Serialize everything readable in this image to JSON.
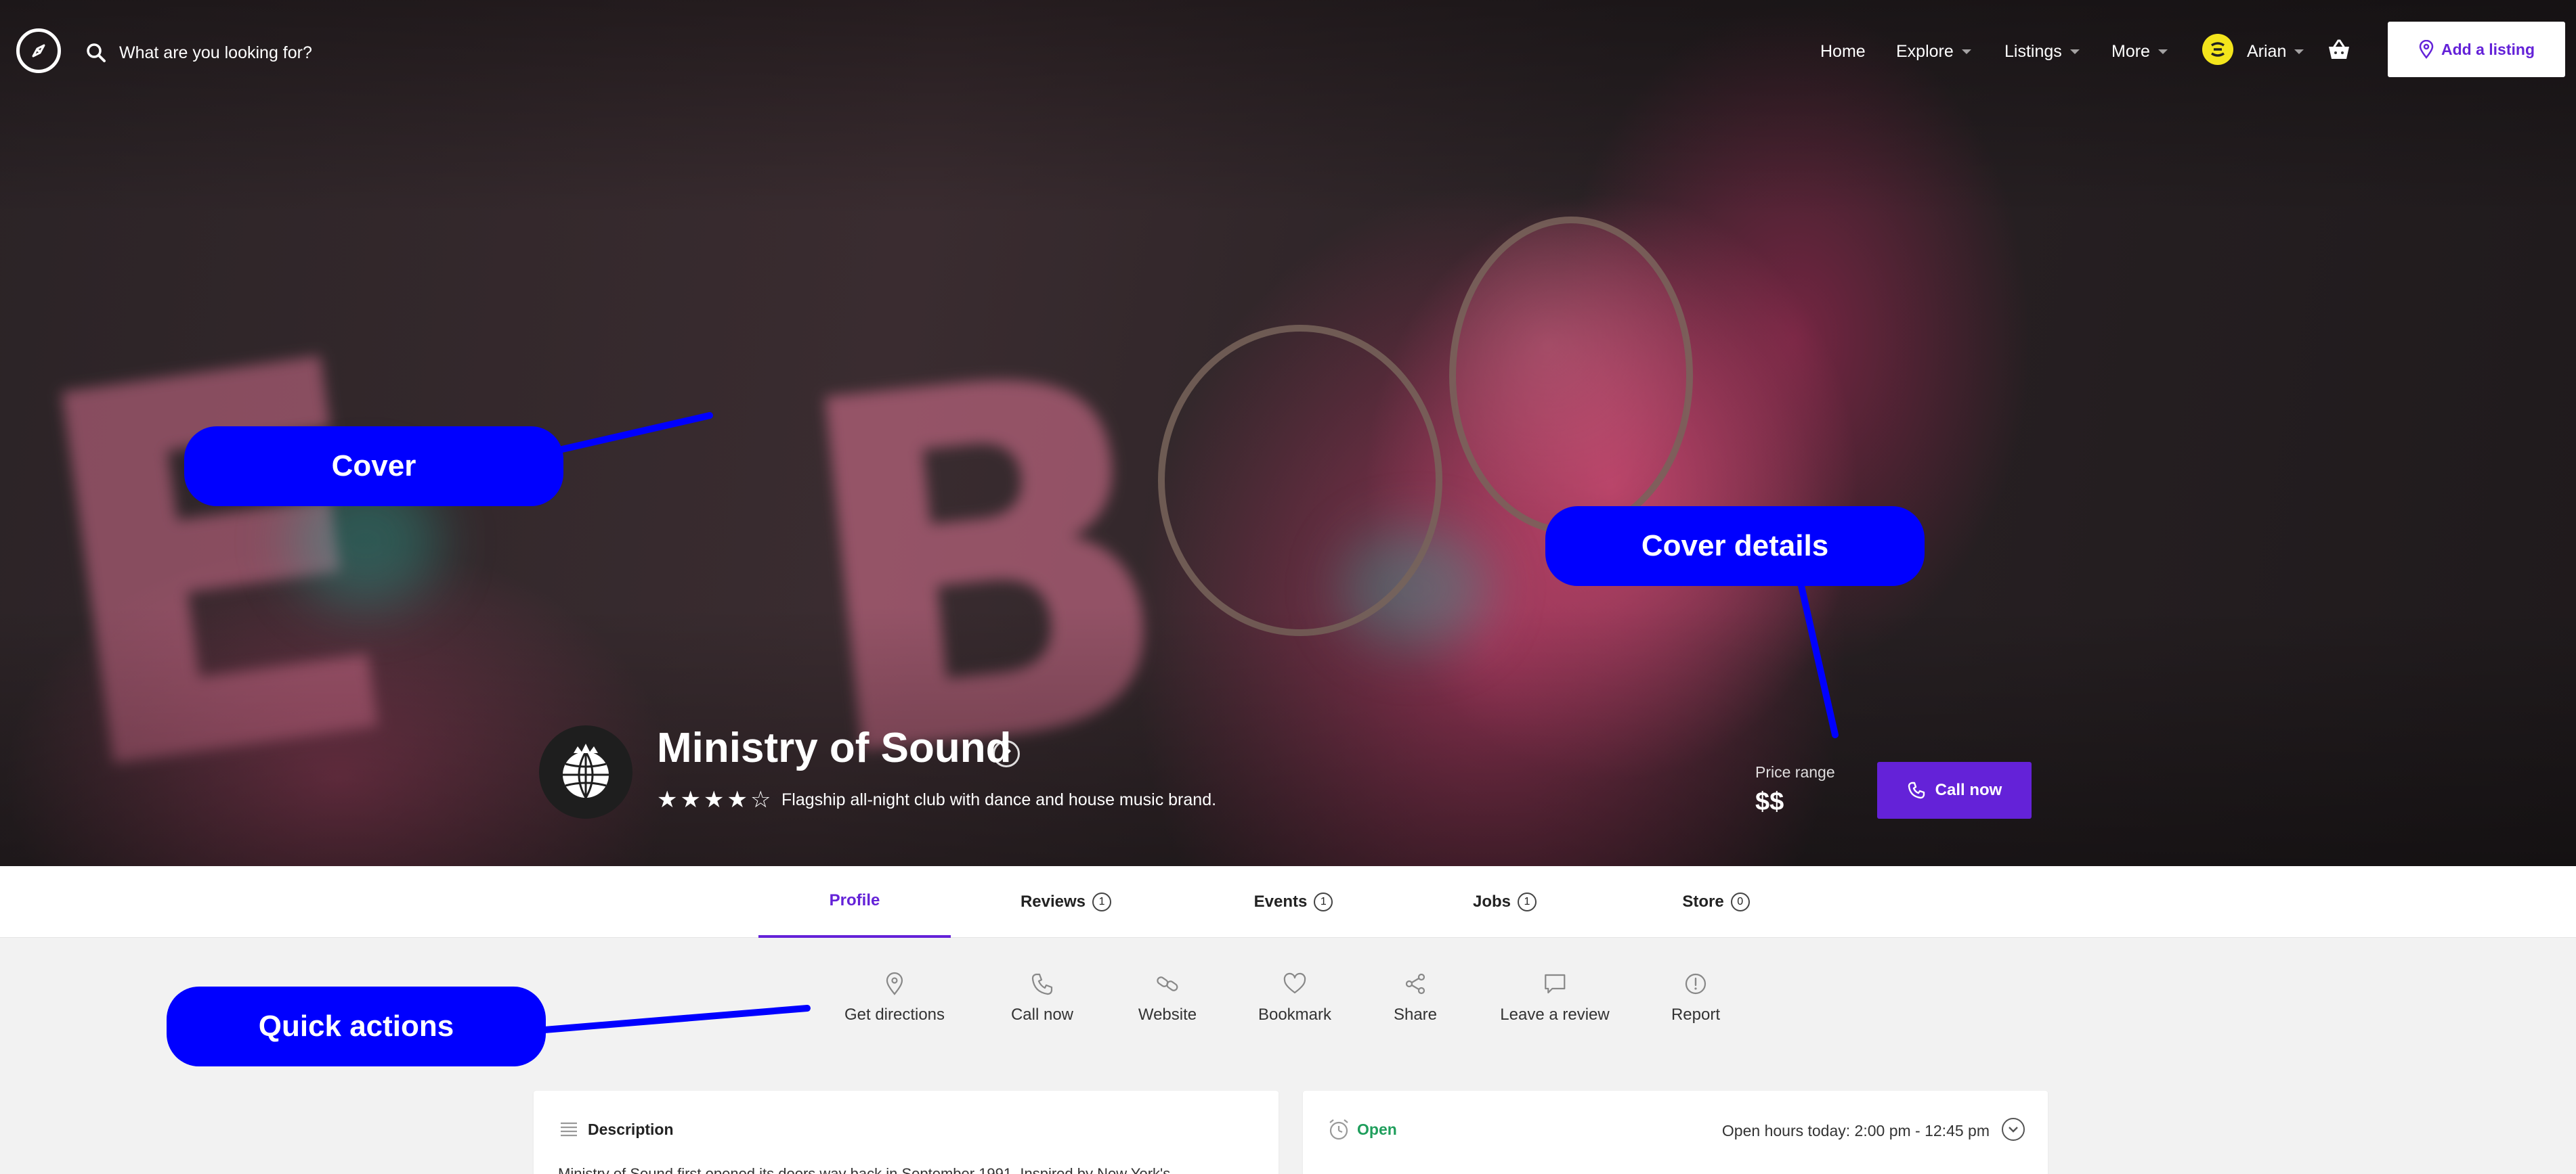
{
  "header": {
    "search_placeholder": "What are you looking for?",
    "nav": {
      "home": "Home",
      "explore": "Explore",
      "listings": "Listings",
      "more": "More",
      "user": "Arian"
    },
    "add_listing": "Add a listing"
  },
  "listing": {
    "title": "Ministry of Sound",
    "rating": 4,
    "rating_max": 5,
    "tagline": "Flagship all-night club with dance and house music brand.",
    "price_label": "Price range",
    "price_value": "$$",
    "call_button": "Call now"
  },
  "tabs": [
    {
      "label": "Profile",
      "count": null,
      "active": true
    },
    {
      "label": "Reviews",
      "count": "1"
    },
    {
      "label": "Events",
      "count": "1"
    },
    {
      "label": "Jobs",
      "count": "1"
    },
    {
      "label": "Store",
      "count": "0"
    }
  ],
  "quick_actions": [
    {
      "label": "Get directions",
      "icon": "map-pin-icon"
    },
    {
      "label": "Call now",
      "icon": "phone-icon"
    },
    {
      "label": "Website",
      "icon": "link-icon"
    },
    {
      "label": "Bookmark",
      "icon": "heart-icon"
    },
    {
      "label": "Share",
      "icon": "share-icon"
    },
    {
      "label": "Leave a review",
      "icon": "comment-icon"
    },
    {
      "label": "Report",
      "icon": "alert-icon"
    }
  ],
  "description": {
    "heading": "Description",
    "text": "Ministry of Sound first opened its doors way back in September 1991. Inspired by New York's"
  },
  "hours": {
    "status": "Open",
    "today": "Open hours today: 2:00 pm - 12:45 pm"
  },
  "annotations": {
    "cover": "Cover",
    "cover_details": "Cover details",
    "quick_actions": "Quick actions"
  },
  "colors": {
    "accent": "#6422d8",
    "annotation": "#0000ff",
    "open_status": "#1f9e5c"
  }
}
